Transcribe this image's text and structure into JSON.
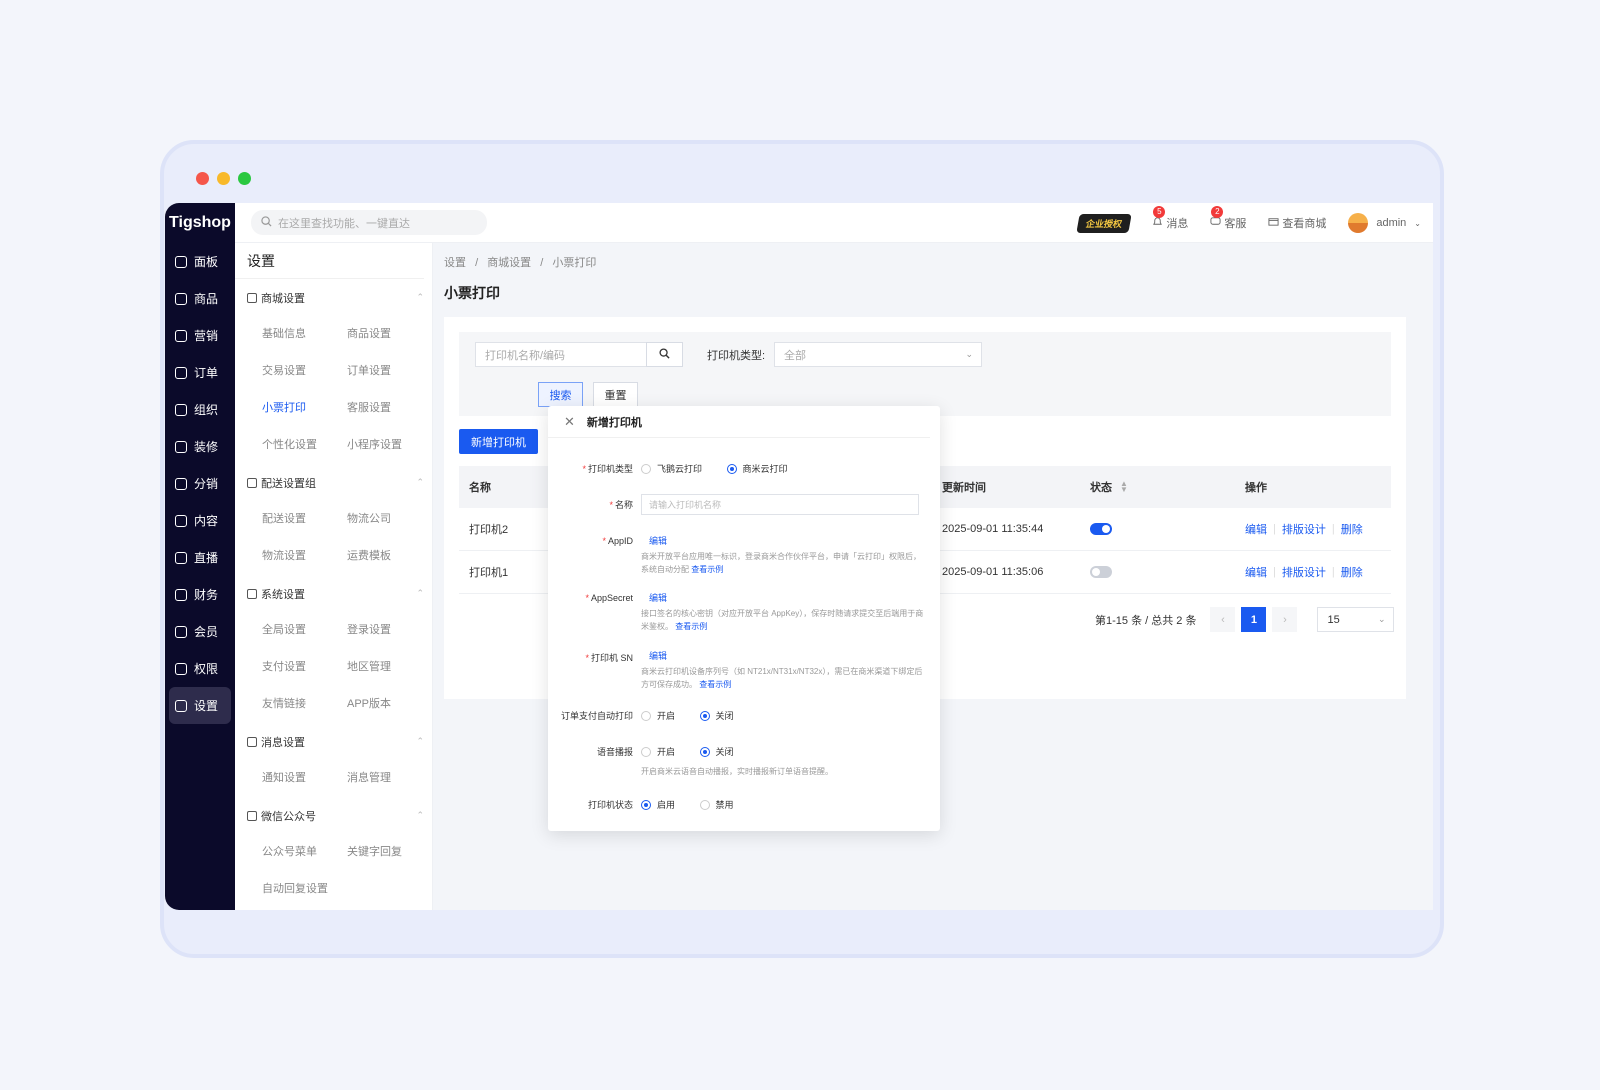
{
  "window": {
    "dot_colors": [
      "#f5564a",
      "#f8b92a",
      "#2bc840"
    ]
  },
  "topbar": {
    "logo": "Tigshop",
    "search_placeholder": "在这里查找功能、一键直达",
    "enterprise_badge": "企业授权",
    "messages_label": "消息",
    "messages_count": "5",
    "service_label": "客服",
    "service_count": "2",
    "view_store_label": "查看商城",
    "user_name": "admin"
  },
  "main_nav": [
    {
      "label": "面板",
      "icon": "dashboard-icon"
    },
    {
      "label": "商品",
      "icon": "cube-icon"
    },
    {
      "label": "营销",
      "icon": "store-icon"
    },
    {
      "label": "订单",
      "icon": "order-icon"
    },
    {
      "label": "组织",
      "icon": "org-icon"
    },
    {
      "label": "装修",
      "icon": "brush-icon"
    },
    {
      "label": "分销",
      "icon": "share-icon"
    },
    {
      "label": "内容",
      "icon": "content-icon"
    },
    {
      "label": "直播",
      "icon": "live-icon"
    },
    {
      "label": "财务",
      "icon": "finance-icon"
    },
    {
      "label": "会员",
      "icon": "crown-icon"
    },
    {
      "label": "权限",
      "icon": "shield-icon"
    },
    {
      "label": "设置",
      "icon": "settings-icon"
    }
  ],
  "settings_nav": {
    "title": "设置",
    "groups": [
      {
        "title": "商城设置",
        "items": [
          "基础信息",
          "商品设置",
          "交易设置",
          "订单设置",
          "小票打印",
          "客服设置",
          "个性化设置",
          "小程序设置"
        ]
      },
      {
        "title": "配送设置组",
        "items": [
          "配送设置",
          "物流公司",
          "物流设置",
          "运费模板"
        ]
      },
      {
        "title": "系统设置",
        "items": [
          "全局设置",
          "登录设置",
          "支付设置",
          "地区管理",
          "友情链接",
          "APP版本"
        ]
      },
      {
        "title": "消息设置",
        "items": [
          "通知设置",
          "消息管理"
        ]
      },
      {
        "title": "微信公众号",
        "items": [
          "公众号菜单",
          "关键字回复",
          "自动回复设置"
        ]
      }
    ]
  },
  "page": {
    "breadcrumb": [
      "设置",
      "商城设置",
      "小票打印"
    ],
    "breadcrumb_sep": "/",
    "title": "小票打印",
    "search_placeholder": "打印机名称/编码",
    "type_label": "打印机类型:",
    "type_value": "全部",
    "search_btn": "搜索",
    "reset_btn": "重置",
    "add_btn": "新增打印机",
    "columns": {
      "name": "名称",
      "updated": "更新时间",
      "status": "状态",
      "actions": "操作"
    },
    "rows": [
      {
        "name": "打印机2",
        "updated": "2025-09-01 11:35:44",
        "enabled": true
      },
      {
        "name": "打印机1",
        "updated": "2025-09-01 11:35:06",
        "enabled": false
      }
    ],
    "row_actions": [
      "编辑",
      "排版设计",
      "删除"
    ],
    "pagination": {
      "summary": "第1-15 条 / 总共 2 条",
      "current": "1",
      "page_size": "15"
    }
  },
  "modal": {
    "title": "新增打印机",
    "printer_type_label": "打印机类型",
    "printer_type_options": [
      "飞鹅云打印",
      "商米云打印"
    ],
    "printer_type_selected": 1,
    "name_label": "名称",
    "name_placeholder": "请输入打印机名称",
    "appid_label": "AppID",
    "appid_edit": "编辑",
    "appid_hint": "商米开放平台应用唯一标识，登录商米合作伙伴平台，申请「云打印」权限后，系统自动分配",
    "appid_link": "查看示例",
    "appsecret_label": "AppSecret",
    "appsecret_edit": "编辑",
    "appsecret_hint": "接口签名的核心密钥（对应开放平台 AppKey），保存时随请求提交至后端用于商米鉴权。",
    "appsecret_link": "查看示例",
    "sn_label": "打印机 SN",
    "sn_edit": "编辑",
    "sn_hint": "商米云打印机设备序列号（如 NT21x/NT31x/NT32x），需已在商米渠道下绑定后方可保存成功。",
    "sn_link": "查看示例",
    "auto_print_label": "订单支付自动打印",
    "voice_label": "语音播报",
    "on_off": [
      "开启",
      "关闭"
    ],
    "voice_hint": "开启商米云语音自动播报，实时播报新订单语音提醒。",
    "status_label": "打印机状态",
    "status_options": [
      "启用",
      "禁用"
    ]
  },
  "colors": {
    "primary": "#1a5af0",
    "sidebar_dark": "#0b0a2a",
    "danger": "#f23a3a"
  }
}
